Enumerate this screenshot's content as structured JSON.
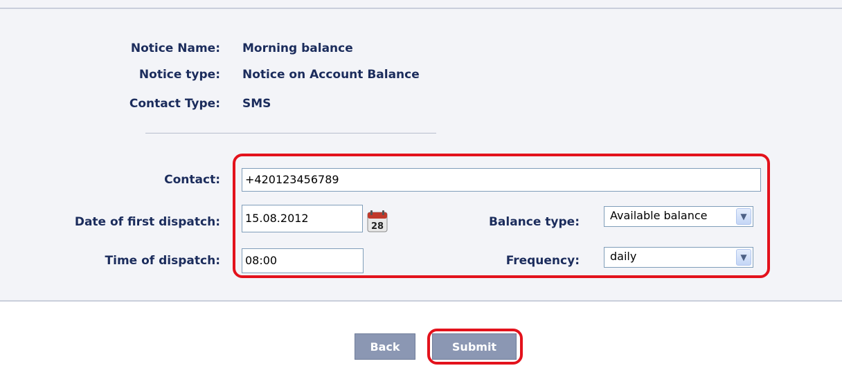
{
  "notice": {
    "name_label": "Notice Name:",
    "name_value": "Morning balance",
    "type_label": "Notice type:",
    "type_value": "Notice on Account Balance",
    "contact_type_label": "Contact Type:",
    "contact_type_value": "SMS"
  },
  "form": {
    "contact_label": "Contact:",
    "contact_value": "+420123456789",
    "date_label": "Date of first dispatch:",
    "date_value": "15.08.2012",
    "calendar_day": "28",
    "time_label": "Time of dispatch:",
    "time_value": "08:00",
    "balance_label": "Balance type:",
    "balance_value": "Available balance",
    "frequency_label": "Frequency:",
    "frequency_value": "daily"
  },
  "buttons": {
    "back_label": "Back",
    "submit_label": "Submit"
  },
  "colors": {
    "highlight": "#e3121c",
    "button_bg": "#8b97b3",
    "label_text": "#1b2c5c"
  },
  "icons": {
    "calendar": "calendar-icon",
    "dropdown": "chevron-down-icon"
  }
}
